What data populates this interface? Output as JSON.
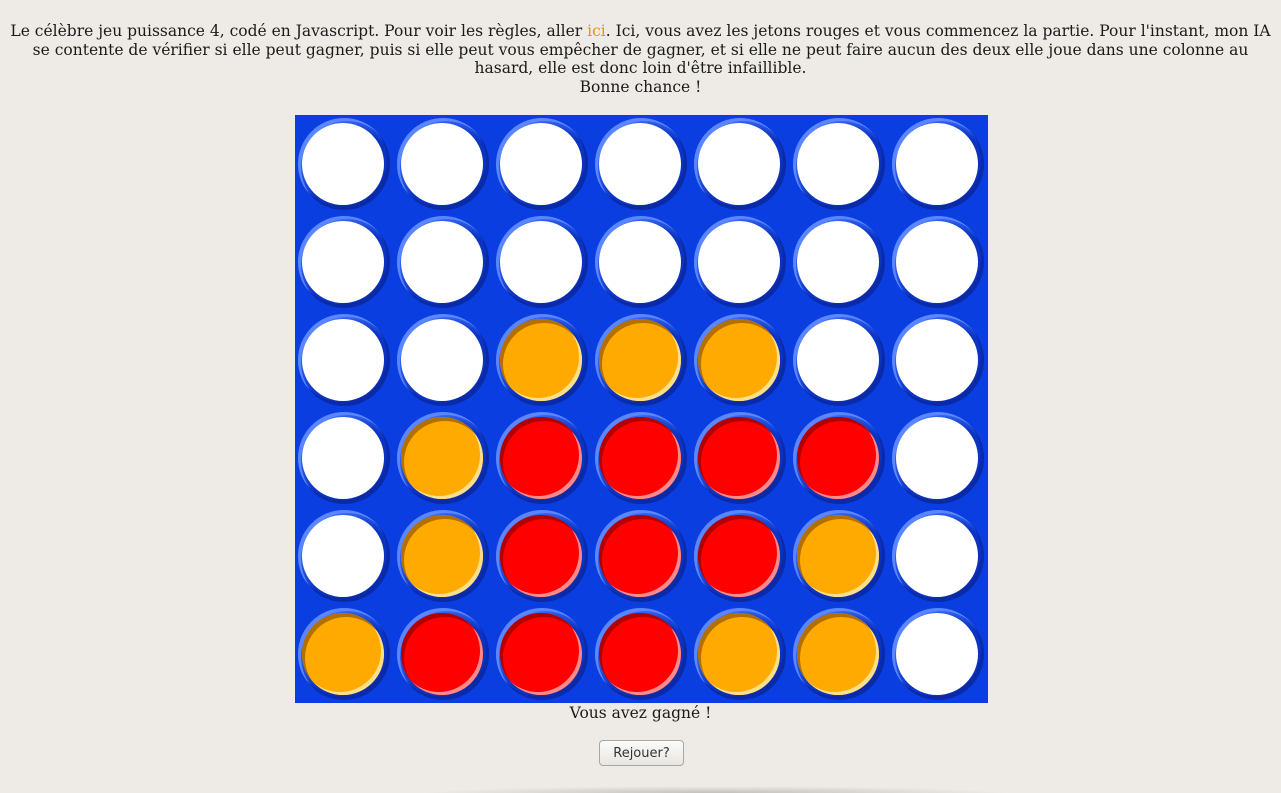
{
  "intro": {
    "text_before_link": "Le célèbre jeu puissance 4, codé en Javascript. Pour voir les règles, aller ",
    "link_label": "ici",
    "text_after_link": ". Ici, vous avez les jetons rouges et vous commencez la partie. Pour l'instant, mon IA se contente de vérifier si elle peut gagner, puis si elle peut vous empêcher de gagner, et si elle ne peut faire aucun des deux elle joue dans une colonne au hasard, elle est donc loin d'être infaillible.",
    "closing": "Bonne chance !"
  },
  "board": {
    "columns": 7,
    "rows": 6,
    "grid": [
      [
        "empty",
        "empty",
        "empty",
        "empty",
        "empty",
        "empty",
        "empty"
      ],
      [
        "empty",
        "empty",
        "empty",
        "empty",
        "empty",
        "empty",
        "empty"
      ],
      [
        "empty",
        "empty",
        "yellow",
        "yellow",
        "yellow",
        "empty",
        "empty"
      ],
      [
        "empty",
        "yellow",
        "red",
        "red",
        "red",
        "red",
        "empty"
      ],
      [
        "empty",
        "yellow",
        "red",
        "red",
        "red",
        "yellow",
        "empty"
      ],
      [
        "yellow",
        "red",
        "red",
        "red",
        "yellow",
        "yellow",
        "empty"
      ]
    ],
    "colors": {
      "board": "#0a3ee0",
      "red": "#fe0000",
      "yellow": "#ffaa00",
      "empty": "#ffffff"
    }
  },
  "status": {
    "message": "Vous avez gagné !"
  },
  "controls": {
    "replay_label": "Rejouer?"
  }
}
